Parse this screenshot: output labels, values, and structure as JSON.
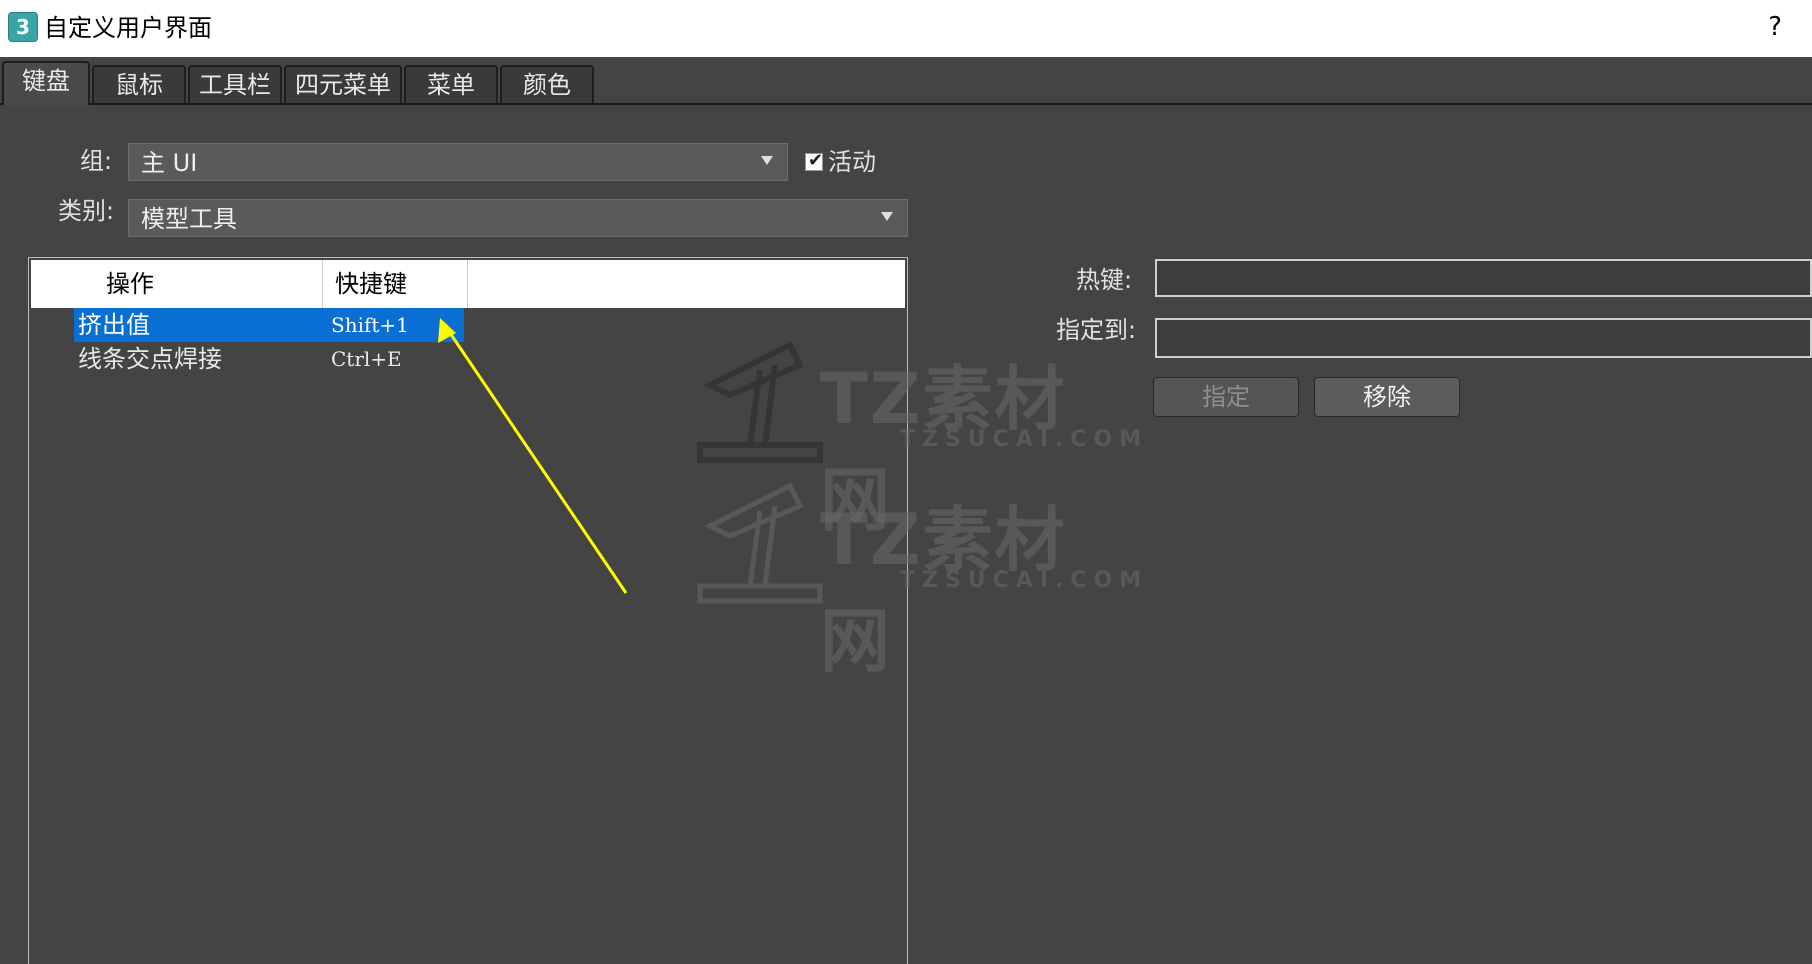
{
  "window": {
    "title": "自定义用户界面",
    "app_icon_glyph": "3",
    "help_label": "?"
  },
  "tabs": [
    {
      "label": "键盘",
      "active": true
    },
    {
      "label": "鼠标",
      "active": false
    },
    {
      "label": "工具栏",
      "active": false
    },
    {
      "label": "四元菜单",
      "active": false
    },
    {
      "label": "菜单",
      "active": false
    },
    {
      "label": "颜色",
      "active": false
    }
  ],
  "form": {
    "group_label": "组:",
    "group_value": "主 UI",
    "active_label": "活动",
    "active_checked": true,
    "category_label": "类别:",
    "category_value": "模型工具"
  },
  "list": {
    "columns": [
      "操作",
      "快捷键"
    ],
    "rows": [
      {
        "action": "挤出值",
        "shortcut": "Shift+1",
        "selected": true
      },
      {
        "action": "线条交点焊接",
        "shortcut": "Ctrl+E",
        "selected": false
      }
    ]
  },
  "hotkey_panel": {
    "hotkey_label": "热键:",
    "hotkey_value": "",
    "assigned_label": "指定到:",
    "assigned_value": "",
    "assign_button": "指定",
    "remove_button": "移除"
  },
  "watermark": {
    "text": "TZ素材网",
    "sub": "TZSUCAI.COM"
  },
  "annotation": {
    "arrow_color": "#ffff00"
  }
}
